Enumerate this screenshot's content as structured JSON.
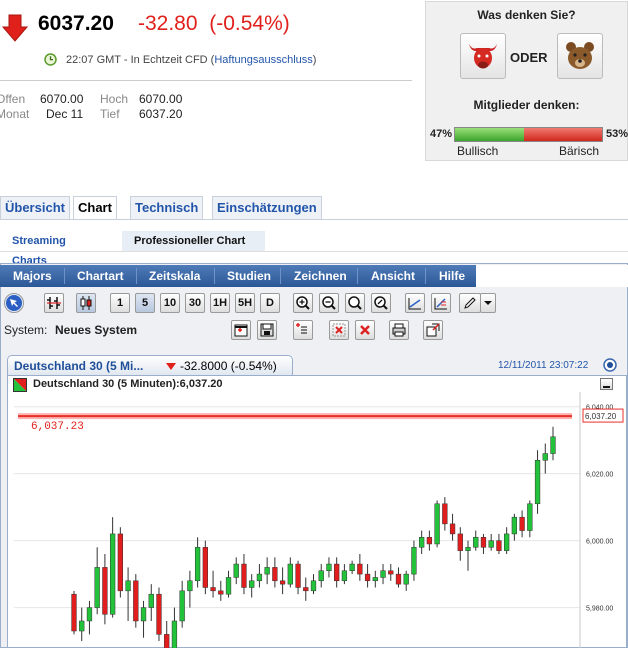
{
  "quote": {
    "last": "6037.20",
    "change": "-32.80",
    "change_pct": "(-0.54%)",
    "time": "22:07 GMT - In Echtzeit CFD (",
    "disclaimer_link": "Haftungsausschluss",
    "time_close": ")",
    "open_label": "Offen",
    "open_value": "6070.00",
    "month_label": "Monat",
    "month_value": "Dec 11",
    "high_label": "Hoch",
    "high_value": "6070.00",
    "low_label": "Tief",
    "low_value": "6037.20"
  },
  "sentiment": {
    "title": "Was denken Sie?",
    "or": "ODER",
    "members": "Mitglieder denken:",
    "bull_pct": "47%",
    "bear_pct": "53%",
    "bull_label": "Bullisch",
    "bear_label": "Bärisch",
    "bull_fraction": 0.47,
    "bear_fraction": 0.53
  },
  "tabs": [
    "Übersicht",
    "Chart",
    "Technisch",
    "Einschätzungen"
  ],
  "active_tab": "Chart",
  "subtabs": [
    "Streaming Charts",
    "Professioneller Chart"
  ],
  "active_subtab": "Professioneller Chart",
  "menu": [
    "Majors",
    "Chartart",
    "Zeitskala",
    "Studien",
    "Zeichnen",
    "Ansicht",
    "Hilfe"
  ],
  "timeframes": [
    "1",
    "5",
    "10",
    "30",
    "1H",
    "5H",
    "D"
  ],
  "active_timeframe": "5",
  "system": {
    "label": "System:",
    "value": "Neues System"
  },
  "chart_tab": {
    "name": "Deutschland 30 (5 Mi...",
    "change": "-32.8000 (-0.54%)",
    "datetime": "12/11/2011 23:07:22"
  },
  "chart_data": {
    "type": "candlestick",
    "series_label": "Deutschland 30 (5 Minuten):6,037.20",
    "last_price_label": "6,037.23",
    "last_price_tag": "6,037.20",
    "y_ticks": [
      "6,040.00",
      "6,020.00",
      "6,000.00",
      "5,980.00"
    ],
    "y_tick_values": [
      6040,
      6020,
      6000,
      5980
    ],
    "ylim": [
      5972,
      6042
    ],
    "last_price_line": 6037.2,
    "colors": {
      "up": "#22c33a",
      "down": "#e21d1d",
      "last_line": "#e8302a"
    },
    "candles": [
      [
        5984,
        5985,
        5972,
        5973
      ],
      [
        5973,
        5980,
        5970,
        5976
      ],
      [
        5976,
        5982,
        5972,
        5980
      ],
      [
        5980,
        5998,
        5978,
        5992
      ],
      [
        5992,
        5996,
        5975,
        5978
      ],
      [
        5978,
        6007,
        5977,
        6002
      ],
      [
        6002,
        6004,
        5983,
        5985
      ],
      [
        5985,
        5992,
        5976,
        5988
      ],
      [
        5988,
        5990,
        5974,
        5976
      ],
      [
        5976,
        5982,
        5971,
        5980
      ],
      [
        5980,
        5987,
        5976,
        5984
      ],
      [
        5984,
        5986,
        5970,
        5972
      ],
      [
        5972,
        5976,
        5964,
        5966
      ],
      [
        5966,
        5980,
        5964,
        5976
      ],
      [
        5976,
        5988,
        5974,
        5985
      ],
      [
        5985,
        5991,
        5980,
        5988
      ],
      [
        5988,
        6001,
        5986,
        5998
      ],
      [
        5998,
        6000,
        5984,
        5986
      ],
      [
        5986,
        5991,
        5983,
        5985
      ],
      [
        5985,
        5988,
        5982,
        5984
      ],
      [
        5984,
        5991,
        5983,
        5989
      ],
      [
        5989,
        5995,
        5987,
        5993
      ],
      [
        5993,
        5996,
        5984,
        5986
      ],
      [
        5986,
        5990,
        5983,
        5988
      ],
      [
        5988,
        5993,
        5986,
        5990
      ],
      [
        5990,
        5995,
        5987,
        5992
      ],
      [
        5992,
        5995,
        5986,
        5988
      ],
      [
        5988,
        5992,
        5984,
        5987
      ],
      [
        5987,
        5995,
        5986,
        5993
      ],
      [
        5993,
        5994,
        5984,
        5986
      ],
      [
        5986,
        5989,
        5982,
        5985
      ],
      [
        5985,
        5990,
        5984,
        5988
      ],
      [
        5988,
        5993,
        5986,
        5991
      ],
      [
        5991,
        5995,
        5989,
        5993
      ],
      [
        5993,
        5995,
        5986,
        5988
      ],
      [
        5988,
        5993,
        5987,
        5991
      ],
      [
        5991,
        5994,
        5990,
        5993
      ],
      [
        5993,
        5996,
        5988,
        5990
      ],
      [
        5990,
        5993,
        5986,
        5988
      ],
      [
        5988,
        5991,
        5986,
        5989
      ],
      [
        5989,
        5993,
        5987,
        5991
      ],
      [
        5991,
        5993,
        5988,
        5990
      ],
      [
        5990,
        5992,
        5986,
        5987
      ],
      [
        5987,
        5991,
        5985,
        5990
      ],
      [
        5990,
        6000,
        5988,
        5998
      ],
      [
        5998,
        6003,
        5996,
        6001
      ],
      [
        6001,
        6003,
        5997,
        5999
      ],
      [
        5999,
        6012,
        5998,
        6011
      ],
      [
        6011,
        6013,
        6003,
        6005
      ],
      [
        6005,
        6008,
        6000,
        6002
      ],
      [
        6002,
        6004,
        5994,
        5997
      ],
      [
        5997,
        6000,
        5991,
        5998
      ],
      [
        5998,
        6003,
        5997,
        6001
      ],
      [
        6001,
        6002,
        5996,
        5998
      ],
      [
        5998,
        6002,
        5997,
        6000
      ],
      [
        6000,
        6002,
        5996,
        5997
      ],
      [
        5997,
        6004,
        5996,
        6002
      ],
      [
        6002,
        6008,
        6000,
        6007
      ],
      [
        6007,
        6009,
        6001,
        6003
      ],
      [
        6003,
        6012,
        6001,
        6011
      ],
      [
        6011,
        6027,
        6008,
        6024
      ],
      [
        6024,
        6029,
        6020,
        6026
      ],
      [
        6026,
        6034,
        6024,
        6031
      ]
    ]
  }
}
